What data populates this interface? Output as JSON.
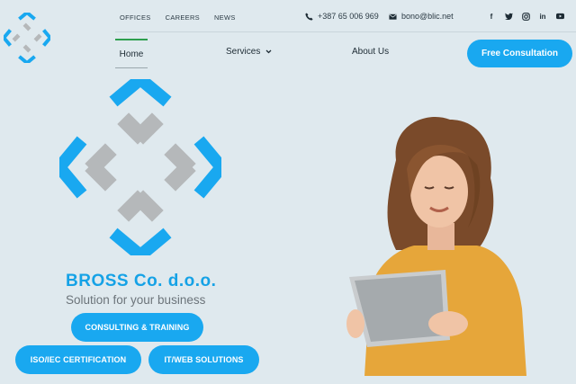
{
  "top_nav": {
    "offices": "OFFICES",
    "careers": "CAREERS",
    "news": "NEWS"
  },
  "contact": {
    "phone": "+387 65 006 969",
    "email": "bono@blic.net"
  },
  "socials": [
    "facebook-icon",
    "twitter-icon",
    "instagram-icon",
    "linkedin-icon",
    "youtube-icon"
  ],
  "main_nav": {
    "home": "Home",
    "services": "Services",
    "about": "About Us",
    "cta": "Free Consultation"
  },
  "hero": {
    "company": "BROSS Co. d.o.o.",
    "tagline": "Solution for your business",
    "buttons": {
      "consulting": "CONSULTING & TRAINING",
      "iso": "ISO/IEC CERTIFICATION",
      "it": "IT/WEB SOLUTIONS"
    }
  },
  "colors": {
    "accent": "#19a8f0",
    "background": "#dfe9ee",
    "active_underline": "#2e9f4e"
  }
}
